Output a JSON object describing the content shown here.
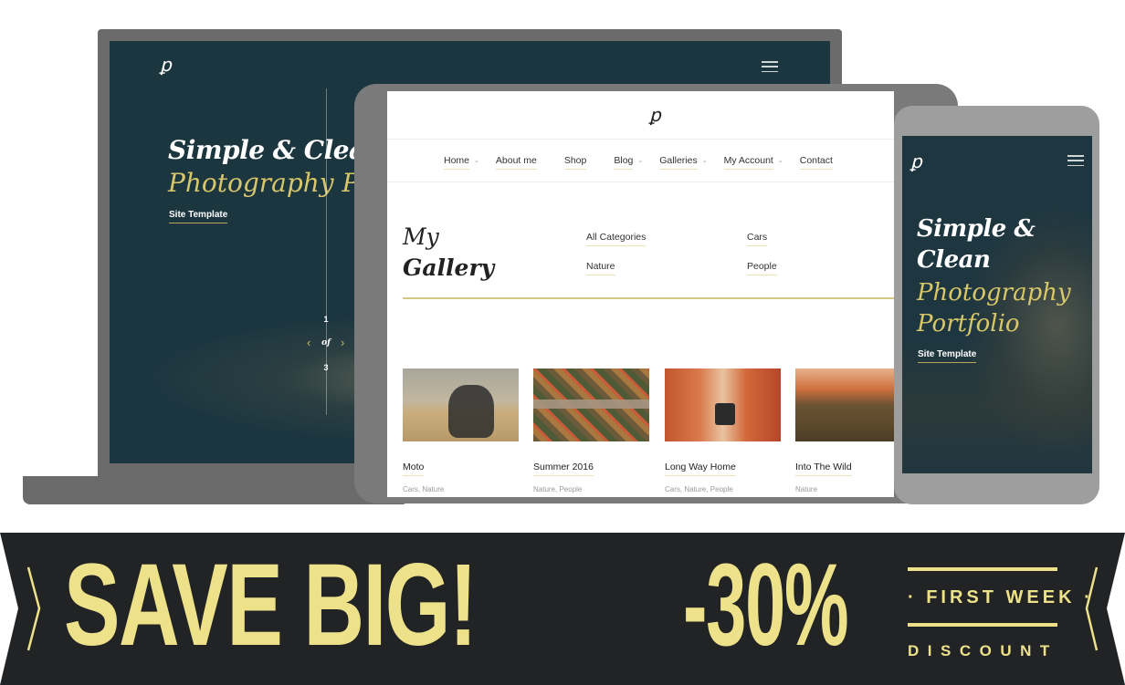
{
  "brand": {
    "logo_glyph": "ꝑ",
    "accent_color": "#d8c76a",
    "dark_bg_color": "#1c3640",
    "banner_bg_color": "#212325",
    "banner_text_color": "#ede18a"
  },
  "laptop": {
    "logo_icon": "p-logo-icon",
    "menu_icon": "hamburger-icon",
    "hero_title": "Simple & Clean",
    "hero_subtitle": "Photography Portfolio",
    "hero_link": "Site Template",
    "slider": {
      "current": "1",
      "separator": "of",
      "total": "3",
      "prev_icon": "‹",
      "next_icon": "›"
    }
  },
  "tablet": {
    "logo_icon": "p-logo-icon",
    "nav": [
      {
        "label": "Home",
        "has_dropdown": true
      },
      {
        "label": "About me",
        "has_dropdown": false
      },
      {
        "label": "Shop",
        "has_dropdown": false
      },
      {
        "label": "Blog",
        "has_dropdown": true
      },
      {
        "label": "Galleries",
        "has_dropdown": true
      },
      {
        "label": "My Account",
        "has_dropdown": true
      },
      {
        "label": "Contact",
        "has_dropdown": false
      }
    ],
    "dropdown_icon": "⌄",
    "gallery": {
      "title_line1": "My",
      "title_line2": "Gallery",
      "categories": [
        "All Categories",
        "Cars",
        "Nature",
        "People"
      ],
      "items": [
        {
          "title": "Moto",
          "tags": "Cars, Nature",
          "image": "motorcycle-in-desert"
        },
        {
          "title": "Summer 2016",
          "tags": "Nature, People",
          "image": "aerial-highway-interchange"
        },
        {
          "title": "Long Way Home",
          "tags": "Cars, Nature, People",
          "image": "jeep-in-red-canyon"
        },
        {
          "title": "Into The Wild",
          "tags": "Nature",
          "image": "sunset-over-hills"
        }
      ]
    }
  },
  "phone": {
    "logo_icon": "p-logo-icon",
    "menu_icon": "hamburger-icon",
    "hero_title": "Simple & Clean",
    "hero_subtitle": "Photography Portfolio",
    "hero_link": "Site Template"
  },
  "banner": {
    "headline": "SAVE BIG!",
    "discount_value": "-30%",
    "tagline_top": "· FIRST WEEK ·",
    "tagline_bottom": "DISCOUNT"
  }
}
